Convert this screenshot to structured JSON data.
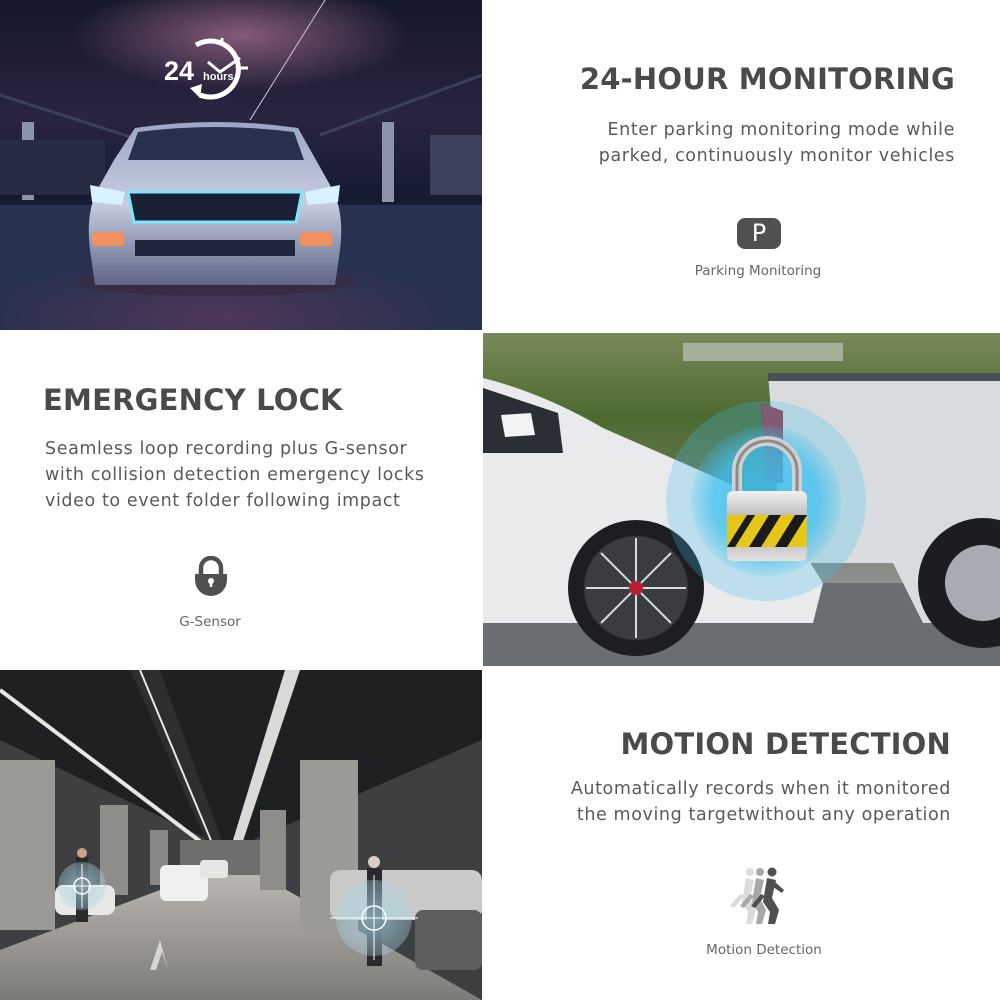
{
  "sections": [
    {
      "id": "24-hour-monitoring",
      "title": "24-HOUR MONITORING",
      "description": [
        "Enter parking monitoring mode while",
        "parked, continuously monitor vehicles"
      ],
      "icon": "parking-p-icon",
      "icon_glyph": "P",
      "icon_label": "Parking Monitoring",
      "photo": {
        "subject": "sports car with blue LED lights in dark parking garage",
        "badge_number": "24",
        "badge_text": "hours",
        "badge_icon": "clock-cycle-icon"
      }
    },
    {
      "id": "emergency-lock",
      "title": "EMERGENCY LOCK",
      "description": [
        "Seamless loop recording plus G-sensor",
        "with collision detection emergency locks",
        "video to event folder following impact"
      ],
      "icon": "padlock-icon",
      "icon_label": "G-Sensor",
      "photo": {
        "subject": "white car rear-ended into pickup truck with blue glow and padlock overlay",
        "overlay_icon": "hazard-padlock-icon"
      }
    },
    {
      "id": "motion-detection",
      "title": "MOTION DETECTION",
      "description": [
        "Automatically records when it monitored",
        "the moving targetwithout any operation"
      ],
      "icon": "running-person-icon",
      "icon_label": "Motion Detection",
      "photo": {
        "subject": "underground parking garage with people targeted by crosshair markers",
        "overlay_icon": "crosshair-target-icon"
      }
    }
  ],
  "colors": {
    "title": "#4a4a4a",
    "body_text": "#5a5a5a",
    "icon_dark": "#505050",
    "glow_blue": "#3cc0f0",
    "hazard_yellow": "#e6c619"
  }
}
